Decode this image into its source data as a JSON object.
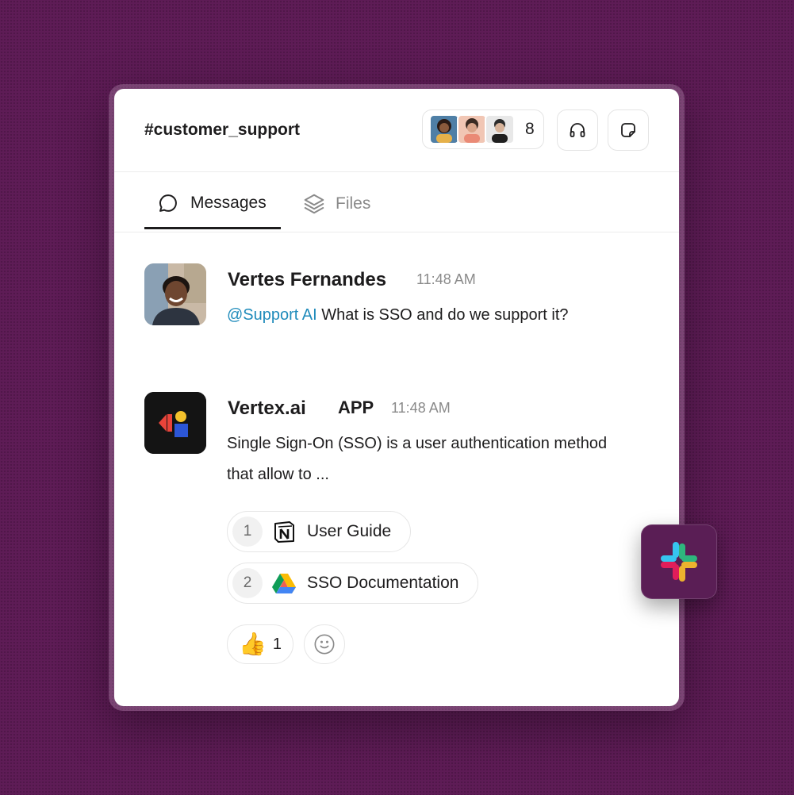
{
  "header": {
    "channel": "#customer_support",
    "member_count": "8"
  },
  "tabs": [
    {
      "label": "Messages",
      "active": true
    },
    {
      "label": "Files",
      "active": false
    }
  ],
  "messages": [
    {
      "author": "Vertes Fernandes",
      "time": "11:48 AM",
      "mention": "@Support AI",
      "text": "What is SSO and do we support it?"
    },
    {
      "author": "Vertex.ai",
      "badge": "APP",
      "time": "11:48 AM",
      "text_line1": "Single Sign-On (SSO) is a user authentication method",
      "text_line2": "that allow to ...",
      "sources": [
        {
          "num": "1",
          "icon": "notion-icon",
          "label": "User Guide"
        },
        {
          "num": "2",
          "icon": "google-drive-icon",
          "label": "SSO Documentation"
        }
      ],
      "reactions": [
        {
          "emoji": "thumbs-up",
          "count": "1"
        }
      ]
    }
  ],
  "colors": {
    "background": "#5e1c56",
    "mention": "#1f8bbb",
    "text": "#1d1c1d"
  }
}
